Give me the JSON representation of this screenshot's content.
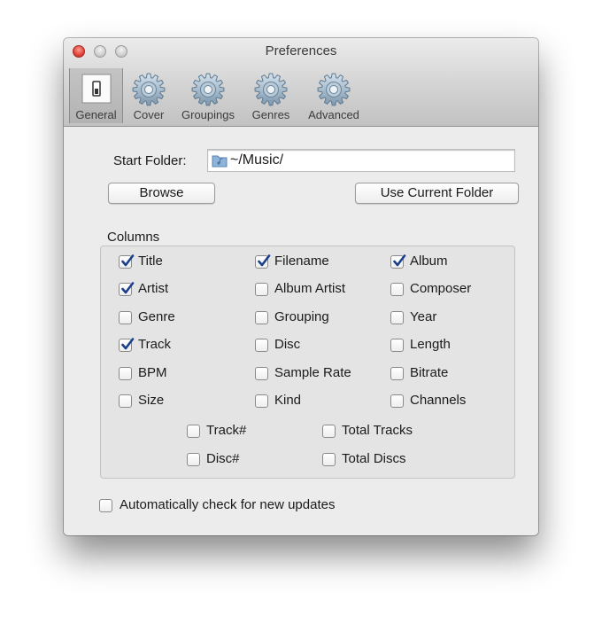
{
  "window": {
    "title": "Preferences"
  },
  "toolbar": {
    "items": [
      {
        "label": "General",
        "icon": "switch-icon",
        "selected": true
      },
      {
        "label": "Cover",
        "icon": "gear-icon"
      },
      {
        "label": "Groupings",
        "icon": "gear-icon"
      },
      {
        "label": "Genres",
        "icon": "gear-icon"
      },
      {
        "label": "Advanced",
        "icon": "gear-icon"
      }
    ]
  },
  "general": {
    "start_folder_label": "Start Folder:",
    "start_folder_value": "~/Music/",
    "browse_label": "Browse",
    "use_current_label": "Use Current Folder",
    "columns_label": "Columns",
    "columns": [
      {
        "label": "Title",
        "checked": true
      },
      {
        "label": "Filename",
        "checked": true
      },
      {
        "label": "Album",
        "checked": true
      },
      {
        "label": "Artist",
        "checked": true
      },
      {
        "label": "Album Artist",
        "checked": false
      },
      {
        "label": "Composer",
        "checked": false
      },
      {
        "label": "Genre",
        "checked": false
      },
      {
        "label": "Grouping",
        "checked": false
      },
      {
        "label": "Year",
        "checked": false
      },
      {
        "label": "Track",
        "checked": true
      },
      {
        "label": "Disc",
        "checked": false
      },
      {
        "label": "Length",
        "checked": false
      },
      {
        "label": "BPM",
        "checked": false
      },
      {
        "label": "Sample Rate",
        "checked": false
      },
      {
        "label": "Bitrate",
        "checked": false
      },
      {
        "label": "Size",
        "checked": false
      },
      {
        "label": "Kind",
        "checked": false
      },
      {
        "label": "Channels",
        "checked": false
      },
      {
        "label": "Track#",
        "checked": false
      },
      {
        "label": "Total Tracks",
        "checked": false
      },
      {
        "label": "Disc#",
        "checked": false
      },
      {
        "label": "Total Discs",
        "checked": false
      }
    ],
    "auto_update_label": "Automatically check for new updates",
    "auto_update_checked": false
  }
}
